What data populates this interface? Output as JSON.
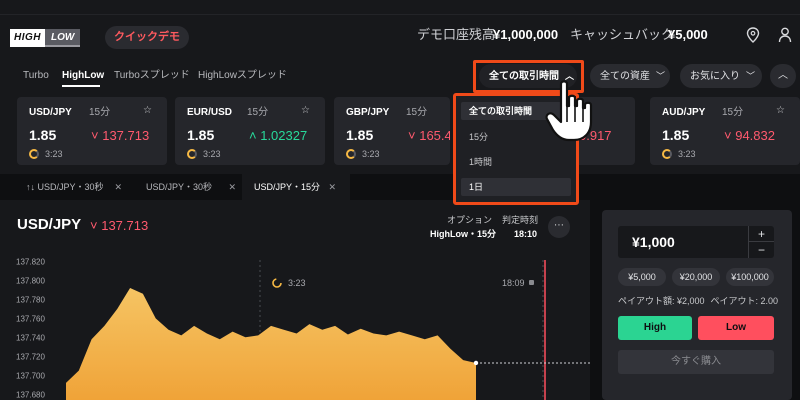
{
  "header": {
    "logo_high": "HIGH",
    "logo_low": "LOW",
    "demo_label": "クイックデモ",
    "balance_label": "デモ口座残高",
    "balance_value": "¥1,000,000",
    "cashback_label": "キャッシュバック",
    "cashback_value": "¥5,000",
    "icons": [
      "map-pin-icon",
      "user-icon"
    ]
  },
  "tabs": {
    "items": [
      "Turbo",
      "HighLow",
      "Turboスプレッド",
      "HighLowスプレッド"
    ],
    "active": "HighLow",
    "filters": {
      "time": "全ての取引時間",
      "asset": "全ての資産",
      "favorite": "お気に入り"
    }
  },
  "cards": [
    {
      "pair": "USD/JPY",
      "duration": "15分",
      "payout": "1.85",
      "price": "137.713",
      "direction": "down",
      "timer": "3:23"
    },
    {
      "pair": "EUR/USD",
      "duration": "15分",
      "payout": "1.85",
      "price": "1.02327",
      "direction": "up",
      "timer": "3:23"
    },
    {
      "pair": "GBP/JPY",
      "duration": "15分",
      "payout": "1.85",
      "price": "165.4",
      "direction": "down",
      "timer": "3:23"
    },
    {
      "pair": "",
      "duration": "",
      "payout": "",
      "price": "0.917",
      "direction": "down",
      "timer": ""
    },
    {
      "pair": "AUD/JPY",
      "duration": "15分",
      "payout": "1.85",
      "price": "94.832",
      "direction": "down",
      "timer": "3:23"
    }
  ],
  "chart_tabs": [
    {
      "label": "USD/JPY・30秒",
      "prefix": "↑↓"
    },
    {
      "label": "USD/JPY・30秒",
      "prefix": ""
    },
    {
      "label": "USD/JPY・15分",
      "prefix": "",
      "active": true
    }
  ],
  "chart_panel": {
    "pair": "USD/JPY",
    "price": "137.713",
    "option_label": "オプション",
    "option_value": "HighLow・15分",
    "deadline_label": "判定時刻",
    "deadline_value": "18:10",
    "timer": "3:23",
    "close_time": "18:09"
  },
  "chart_data": {
    "type": "area",
    "yticks": [
      "137.820",
      "137.800",
      "137.780",
      "137.760",
      "137.740",
      "137.720",
      "137.700",
      "137.680"
    ],
    "values": [
      137.692,
      137.705,
      137.738,
      137.752,
      137.77,
      137.792,
      137.786,
      137.76,
      137.748,
      137.742,
      137.752,
      137.744,
      137.738,
      137.746,
      137.74,
      137.742,
      137.752,
      137.748,
      137.744,
      137.754,
      137.748,
      137.752,
      137.743,
      137.749,
      137.744,
      137.742,
      137.746,
      137.742,
      137.738,
      137.742,
      137.728,
      137.716,
      137.713
    ],
    "ylim": [
      137.674,
      137.832
    ],
    "color": "#f5c463"
  },
  "trade": {
    "amount": "¥1,000",
    "plus": "+",
    "minus": "−",
    "presets": [
      "¥5,000",
      "¥20,000",
      "¥100,000"
    ],
    "payout_amount": "ペイアウト額: ¥2,000",
    "payout_rate": "ペイアウト: 2.00",
    "high_label": "High",
    "low_label": "Low",
    "buy_label": "今すぐ購入"
  },
  "dropdown": {
    "items": [
      "全ての取引時間",
      "15分",
      "1時間",
      "1日"
    ],
    "selected": "全ての取引時間"
  },
  "colors": {
    "accent_red": "#ff5a6e",
    "accent_green": "#2bd492",
    "highlight": "#f04a19"
  }
}
